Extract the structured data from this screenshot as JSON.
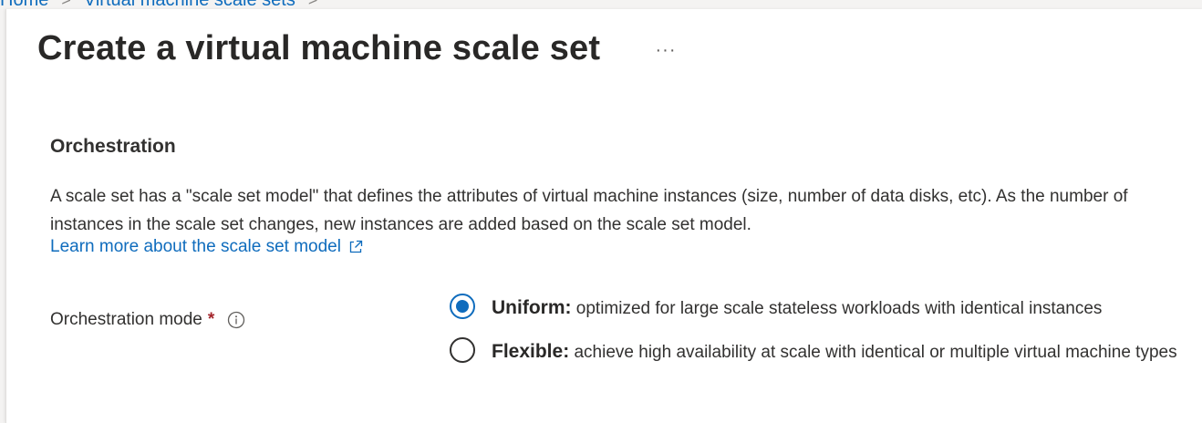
{
  "breadcrumb": {
    "items": [
      "Home",
      "Virtual machine scale sets"
    ],
    "separator": ">"
  },
  "page": {
    "title": "Create a virtual machine scale set",
    "more_label": "···"
  },
  "orchestration": {
    "heading": "Orchestration",
    "description": "A scale set has a \"scale set model\" that defines the attributes of virtual machine instances (size, number of data disks, etc). As the number of instances in the scale set changes, new instances are added based on the scale set model.",
    "learn_more_label": "Learn more about the scale set model",
    "mode_label": "Orchestration mode",
    "required_marker": "*",
    "options": [
      {
        "title": "Uniform:",
        "description": "optimized for large scale stateless workloads with identical instances",
        "selected": true
      },
      {
        "title": "Flexible:",
        "description": "achieve high availability at scale with identical or multiple virtual machine types",
        "selected": false
      }
    ]
  },
  "colors": {
    "accent": "#0f6cbd",
    "required": "#a4262c",
    "text": "#323130"
  },
  "icons": {
    "external_link": "external-link-icon",
    "info": "info-icon",
    "breadcrumb_separator": "chevron-right-icon"
  }
}
